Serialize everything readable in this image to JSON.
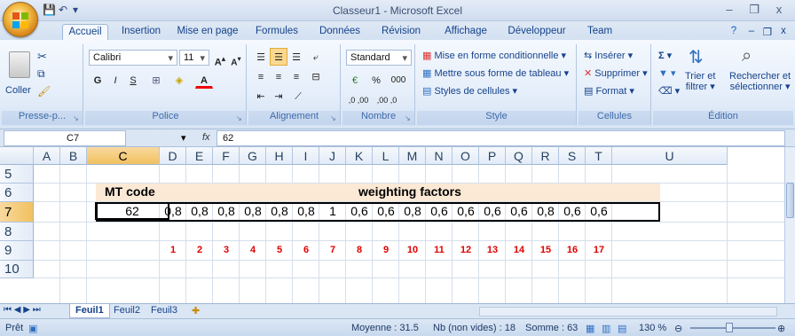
{
  "window": {
    "title": "Classeur1 - Microsoft Excel",
    "minimize": "–",
    "restore": "❐",
    "close": "x",
    "doc_restore": "❐",
    "doc_close": "x",
    "help": "?"
  },
  "quick_access": {
    "save": "💾",
    "undo": "↶",
    "more": "▾"
  },
  "tabs": [
    "Accueil",
    "Insertion",
    "Mise en page",
    "Formules",
    "Données",
    "Révision",
    "Affichage",
    "Développeur",
    "Team"
  ],
  "ribbon": {
    "clipboard": {
      "paste": "Coller",
      "label": "Presse-p..."
    },
    "font": {
      "name": "Calibri",
      "size": "11",
      "label": "Police",
      "bold": "G",
      "italic": "I",
      "underline": "S"
    },
    "alignment": {
      "label": "Alignement"
    },
    "number": {
      "format": "Standard",
      "percent": "%",
      "thousands": "000",
      "label": "Nombre",
      "inc": ",0 ,00",
      "dec": ",00 ,0"
    },
    "style": {
      "cond": "Mise en forme conditionnelle ▾",
      "table": "Mettre sous forme de tableau ▾",
      "cell": "Styles de cellules ▾",
      "label": "Style"
    },
    "cells": {
      "insert": "Insérer ▾",
      "delete": "Supprimer ▾",
      "format": "Format ▾",
      "label": "Cellules"
    },
    "edit": {
      "sort": "Trier et",
      "sort2": "filtrer ▾",
      "find": "Rechercher et",
      "find2": "sélectionner ▾",
      "label": "Édition",
      "sum": "Σ ▾"
    }
  },
  "formula_bar": {
    "cell_ref": "C7",
    "fx": "fx",
    "value": "62"
  },
  "columns": [
    "A",
    "B",
    "C",
    "D",
    "E",
    "F",
    "G",
    "H",
    "I",
    "J",
    "K",
    "L",
    "M",
    "N",
    "O",
    "P",
    "Q",
    "R",
    "S",
    "T",
    "U"
  ],
  "rows": [
    "5",
    "6",
    "7",
    "8",
    "9",
    "10"
  ],
  "sheet": {
    "mt_code_label": "MT code",
    "weighting_label": "weighting factors",
    "mt_code_value": "62",
    "factors": [
      "0,8",
      "0,8",
      "0,8",
      "0,8",
      "0,8",
      "0,8",
      "1",
      "0,6",
      "0,6",
      "0,8",
      "0,6",
      "0,6",
      "0,6",
      "0,6",
      "0,8",
      "0,6",
      "0,6"
    ],
    "indices": [
      "1",
      "2",
      "3",
      "4",
      "5",
      "6",
      "7",
      "8",
      "9",
      "10",
      "11",
      "12",
      "13",
      "14",
      "15",
      "16",
      "17"
    ]
  },
  "sheets": [
    "Feuil1",
    "Feuil2",
    "Feuil3"
  ],
  "status": {
    "ready": "Prêt",
    "average": "Moyenne : 31.5",
    "count": "Nb (non vides) : 18",
    "sum": "Somme : 63",
    "zoom": "130 %"
  }
}
